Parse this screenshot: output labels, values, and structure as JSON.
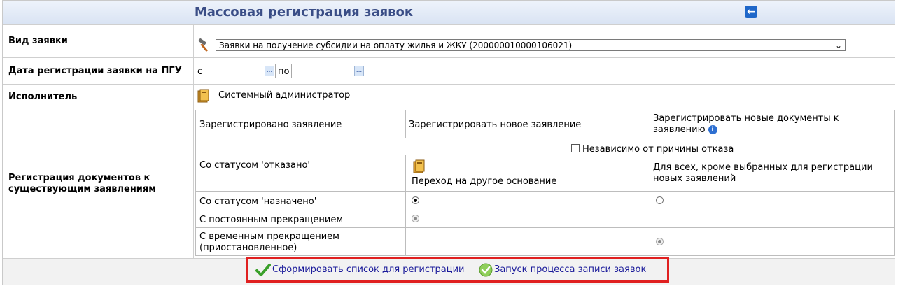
{
  "title": "Массовая регистрация заявок",
  "back_button": "back-arrow",
  "rows": {
    "request_type": {
      "label": "Вид заявки",
      "selected": "Заявки на получение субсидии на оплату жилья и ЖКУ (200000010000106021)"
    },
    "reg_date": {
      "label": "Дата регистрации заявки на ПГУ",
      "from_label": "с",
      "to_label": "по",
      "from_value": "",
      "to_value": "",
      "picker_label": "..."
    },
    "executor": {
      "label": "Исполнитель",
      "value": "Системный администратор"
    },
    "docs": {
      "label_line1": "Регистрация документов к",
      "label_line2": "существующим заявлениям"
    }
  },
  "grid": {
    "headers": {
      "col1": "Зарегистрировано заявление",
      "col2": "Зарегистрировать новое заявление",
      "col3_line1": "Зарегистрировать новые документы к",
      "col3_line2": "заявлению"
    },
    "refused": {
      "label": "Со статусом 'отказано'",
      "checkbox_label": "Независимо от причины отказа",
      "new_request": "Переход на другое основание",
      "new_docs_line1": "Для всех, кроме выбранных для регистрации",
      "new_docs_line2": "новых заявлений"
    },
    "assigned": {
      "label": "Со статусом 'назначено'",
      "new_request_selected": true,
      "new_docs_selected": false
    },
    "permanent": {
      "label": "С постоянным прекращением",
      "new_request_selected": true
    },
    "temporary": {
      "label_line1": "С временным прекращением",
      "label_line2": "(приостановленное)",
      "new_docs_selected": true
    }
  },
  "footer": {
    "form_list": "Сформировать список для регистрации",
    "start_process": "Запуск процесса записи заявок"
  },
  "colors": {
    "title": "#3a4d86",
    "link": "#1a1a9a",
    "highlight": "#e02020"
  }
}
